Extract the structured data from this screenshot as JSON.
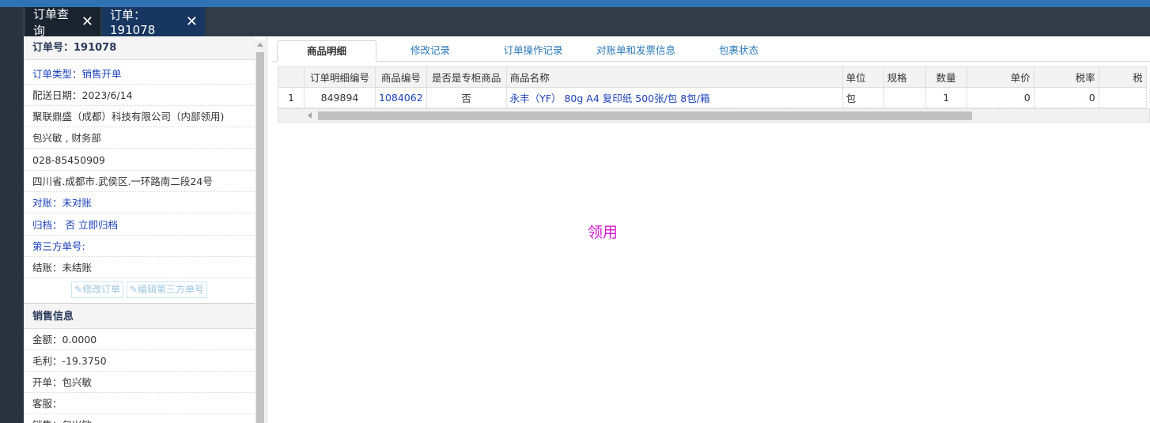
{
  "tabs": [
    {
      "label": "订单查询",
      "close": "✕"
    },
    {
      "label": "订单：191078",
      "close": "✕"
    }
  ],
  "order": {
    "title": "订单号：191078",
    "rows": [
      {
        "text": "订单类型：销售开单",
        "style": "blue"
      },
      {
        "text": "配送日期：2023/6/14",
        "style": "normal"
      },
      {
        "text": "聚联鼎盛（成都）科技有限公司（内部领用)",
        "style": "normal"
      },
      {
        "text": "包兴敏 , 财务部",
        "style": "normal"
      },
      {
        "text": "028-85450909",
        "style": "normal"
      },
      {
        "text": "四川省.成都市.武侯区.一环路南二段24号",
        "style": "normal"
      },
      {
        "text": "对账：未对账",
        "style": "blue"
      },
      {
        "text": "归档：  否 立即归档",
        "style": "blue"
      },
      {
        "text": "第三方单号:",
        "style": "blue"
      },
      {
        "text": "结账：未结账",
        "style": "normal"
      }
    ],
    "buttons": {
      "edit_order": "修改订单",
      "edit_third": "编辑第三方单号"
    }
  },
  "sales": {
    "title": "销售信息",
    "rows": [
      {
        "text": "金额：0.0000"
      },
      {
        "text": "毛利：-19.3750"
      },
      {
        "text": "开单：包兴敏"
      },
      {
        "text": "客服："
      },
      {
        "text": "销售：包兴敏"
      }
    ]
  },
  "subtabs": [
    "商品明细",
    "修改记录",
    "订单操作记录",
    "对账单和发票信息",
    "包裹状态"
  ],
  "grid": {
    "headers": [
      "",
      "订单明细编号",
      "商品编号",
      "是否是专柜商品",
      "商品名称",
      "单位",
      "规格",
      "数量",
      "单价",
      "税率",
      "税"
    ],
    "rows": [
      [
        "1",
        "849894",
        "1084062",
        "否",
        "永丰（YF） 80g A4 复印纸 500张/包 8包/箱",
        "包",
        "",
        "1",
        "0",
        "0",
        ""
      ]
    ]
  },
  "remark": "领用",
  "colors": {
    "topbar": "#2f73b5",
    "tabbar": "#323c48",
    "link": "#1a3fb8",
    "remark": "#d21bd0"
  }
}
